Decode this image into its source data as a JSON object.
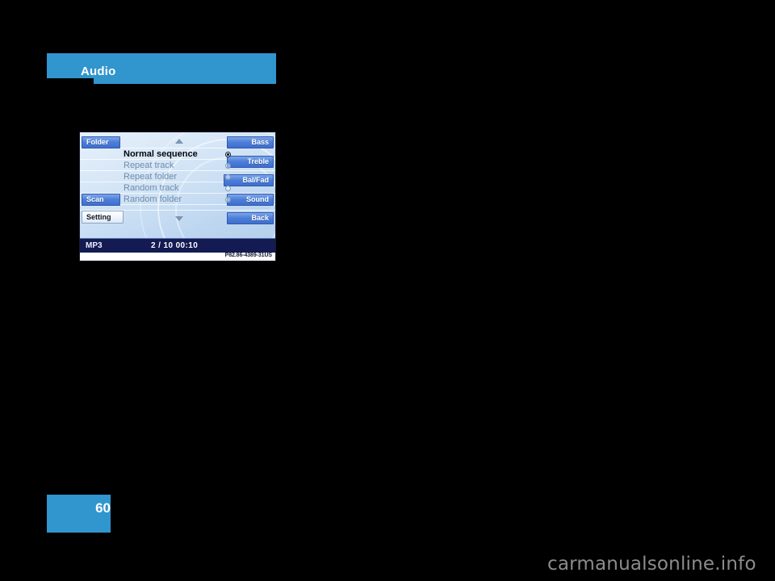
{
  "page": {
    "section_title": "Audio",
    "page_number": "60",
    "watermark": "carmanualsonline.info",
    "accent_color": "#3195ce"
  },
  "figure": {
    "caption": "P82.86-4389-31US",
    "left_buttons": [
      {
        "label": "Folder",
        "style": "blue"
      },
      {
        "label": "Scan",
        "style": "blue"
      },
      {
        "label": "Setting",
        "style": "pale"
      }
    ],
    "right_buttons": [
      {
        "label": "Bass"
      },
      {
        "label": "Treble"
      },
      {
        "label": "Bal/Fad"
      },
      {
        "label": "Sound"
      },
      {
        "label": "Back"
      }
    ],
    "scroll_up_icon": "triangle-up-icon",
    "scroll_down_icon": "triangle-down-icon",
    "options": [
      {
        "label": "Normal sequence",
        "selected": true
      },
      {
        "label": "Repeat track",
        "selected": false
      },
      {
        "label": "Repeat folder",
        "selected": false
      },
      {
        "label": "Random track",
        "selected": false
      },
      {
        "label": "Random folder",
        "selected": false
      }
    ],
    "status_bar": {
      "source": "MP3",
      "track_time": "2 / 10  00:10"
    }
  }
}
